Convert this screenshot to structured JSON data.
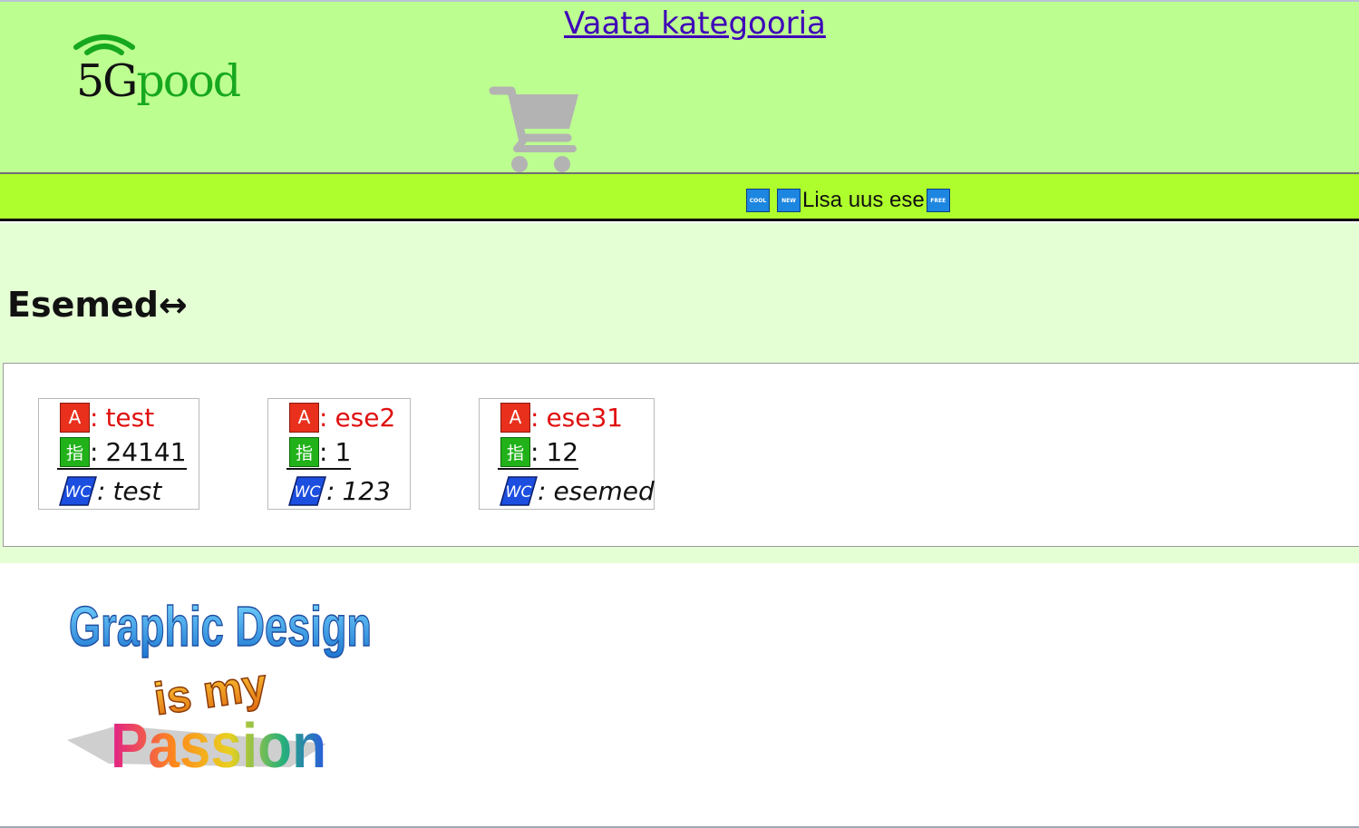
{
  "header": {
    "logo_text": "5Gpood",
    "logo_prefix": "5G",
    "logo_rest": "pood",
    "view_category_link": "Vaata kategooria",
    "cart_icon": "shopping-cart-icon"
  },
  "nav": {
    "badges": [
      "COOL",
      "NEW",
      "FREE"
    ],
    "add_item_label": "Lisa uus ese"
  },
  "main": {
    "title": "Esemed↔",
    "items": [
      {
        "name": "test",
        "price": "24141",
        "category": "test"
      },
      {
        "name": "ese2",
        "price": "1",
        "category": "123"
      },
      {
        "name": "ese31",
        "price": "12",
        "category": "esemed"
      }
    ],
    "labels": {
      "name_badge": "A",
      "price_badge": "指",
      "category_badge": "WC",
      "separator": ":"
    }
  },
  "footer": {
    "image_lines": [
      "Graphic Design",
      "is my",
      "Passion"
    ]
  },
  "colors": {
    "header_bg": "#bdfe90",
    "nav_bg": "#aefe2d",
    "content_bg": "#e5ffd4",
    "link": "#3e00b9",
    "item_name": "#e01010"
  }
}
